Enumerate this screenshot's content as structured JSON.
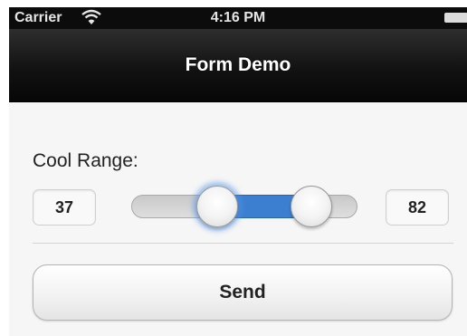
{
  "status_bar": {
    "carrier": "Carrier",
    "time": "4:16 PM",
    "wifi_icon": "wifi-icon",
    "battery_icon": "battery-icon"
  },
  "nav_bar": {
    "title": "Form Demo"
  },
  "form": {
    "range_label": "Cool Range:",
    "range_min_value": "37",
    "range_max_value": "82",
    "slider": {
      "min": 0,
      "max": 100,
      "low": 37,
      "high": 82,
      "fill_color": "#3c7fd1"
    },
    "send_label": "Send"
  }
}
